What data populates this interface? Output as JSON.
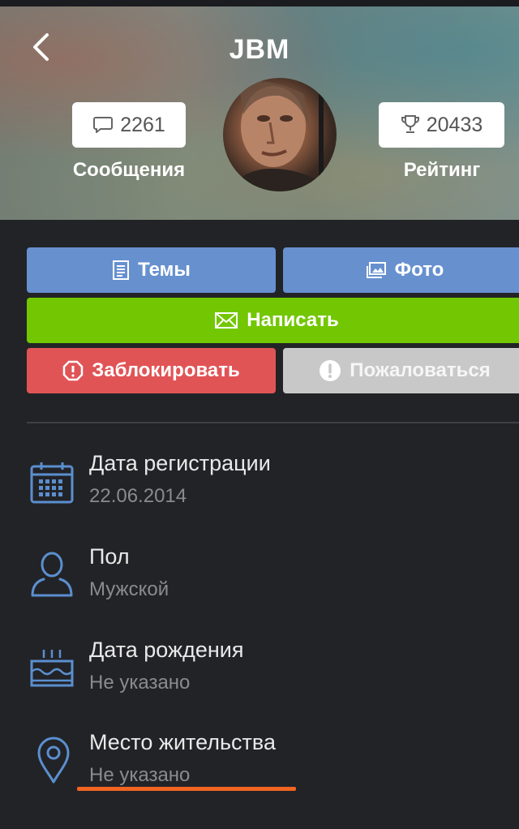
{
  "header": {
    "title": "JBM",
    "messages_count": "2261",
    "messages_label": "Сообщения",
    "rating_count": "20433",
    "rating_label": "Рейтинг"
  },
  "actions": {
    "topics": "Темы",
    "photo": "Фото",
    "write": "Написать",
    "block": "Заблокировать",
    "report": "Пожаловаться"
  },
  "info": [
    {
      "title": "Дата регистрации",
      "value": "22.06.2014",
      "icon": "calendar-icon"
    },
    {
      "title": "Пол",
      "value": "Мужской",
      "icon": "user-icon"
    },
    {
      "title": "Дата рождения",
      "value": "Не указано",
      "icon": "cake-icon"
    },
    {
      "title": "Место жительства",
      "value": "Не указано",
      "icon": "location-pin-icon"
    }
  ],
  "colors": {
    "background": "#222327",
    "button_blue": "#6790cf",
    "button_green": "#72c702",
    "button_red": "#e15456",
    "button_gray": "#c8c8c8",
    "icon_blue": "#5b8fcf",
    "annotation_orange": "#f16522"
  }
}
